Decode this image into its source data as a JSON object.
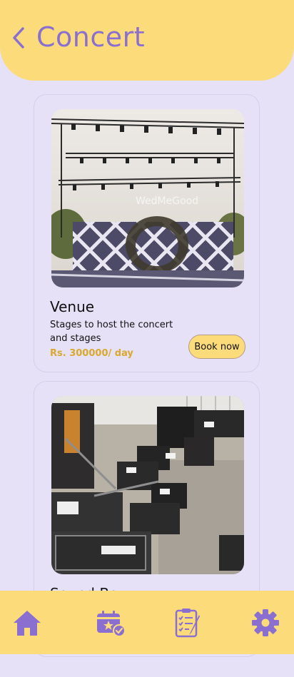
{
  "header": {
    "title": "Concert"
  },
  "cards": [
    {
      "title": "Venue",
      "description": "Stages to host the concert and stages",
      "price": "Rs. 300000/ day",
      "button_label": "Book now",
      "image_alt": "Concert stage with lighting truss",
      "watermark": "WedMeGood"
    },
    {
      "title": "Sound Box",
      "image_alt": "Sound equipment flight cases"
    }
  ],
  "nav": {
    "items": [
      {
        "icon": "home-icon"
      },
      {
        "icon": "calendar-check-icon"
      },
      {
        "icon": "checklist-icon"
      },
      {
        "icon": "gear-icon"
      }
    ]
  },
  "colors": {
    "background": "#E7E1F7",
    "accent_yellow": "#FCDC7A",
    "accent_purple": "#8A6FD1",
    "price": "#D9A82E"
  }
}
